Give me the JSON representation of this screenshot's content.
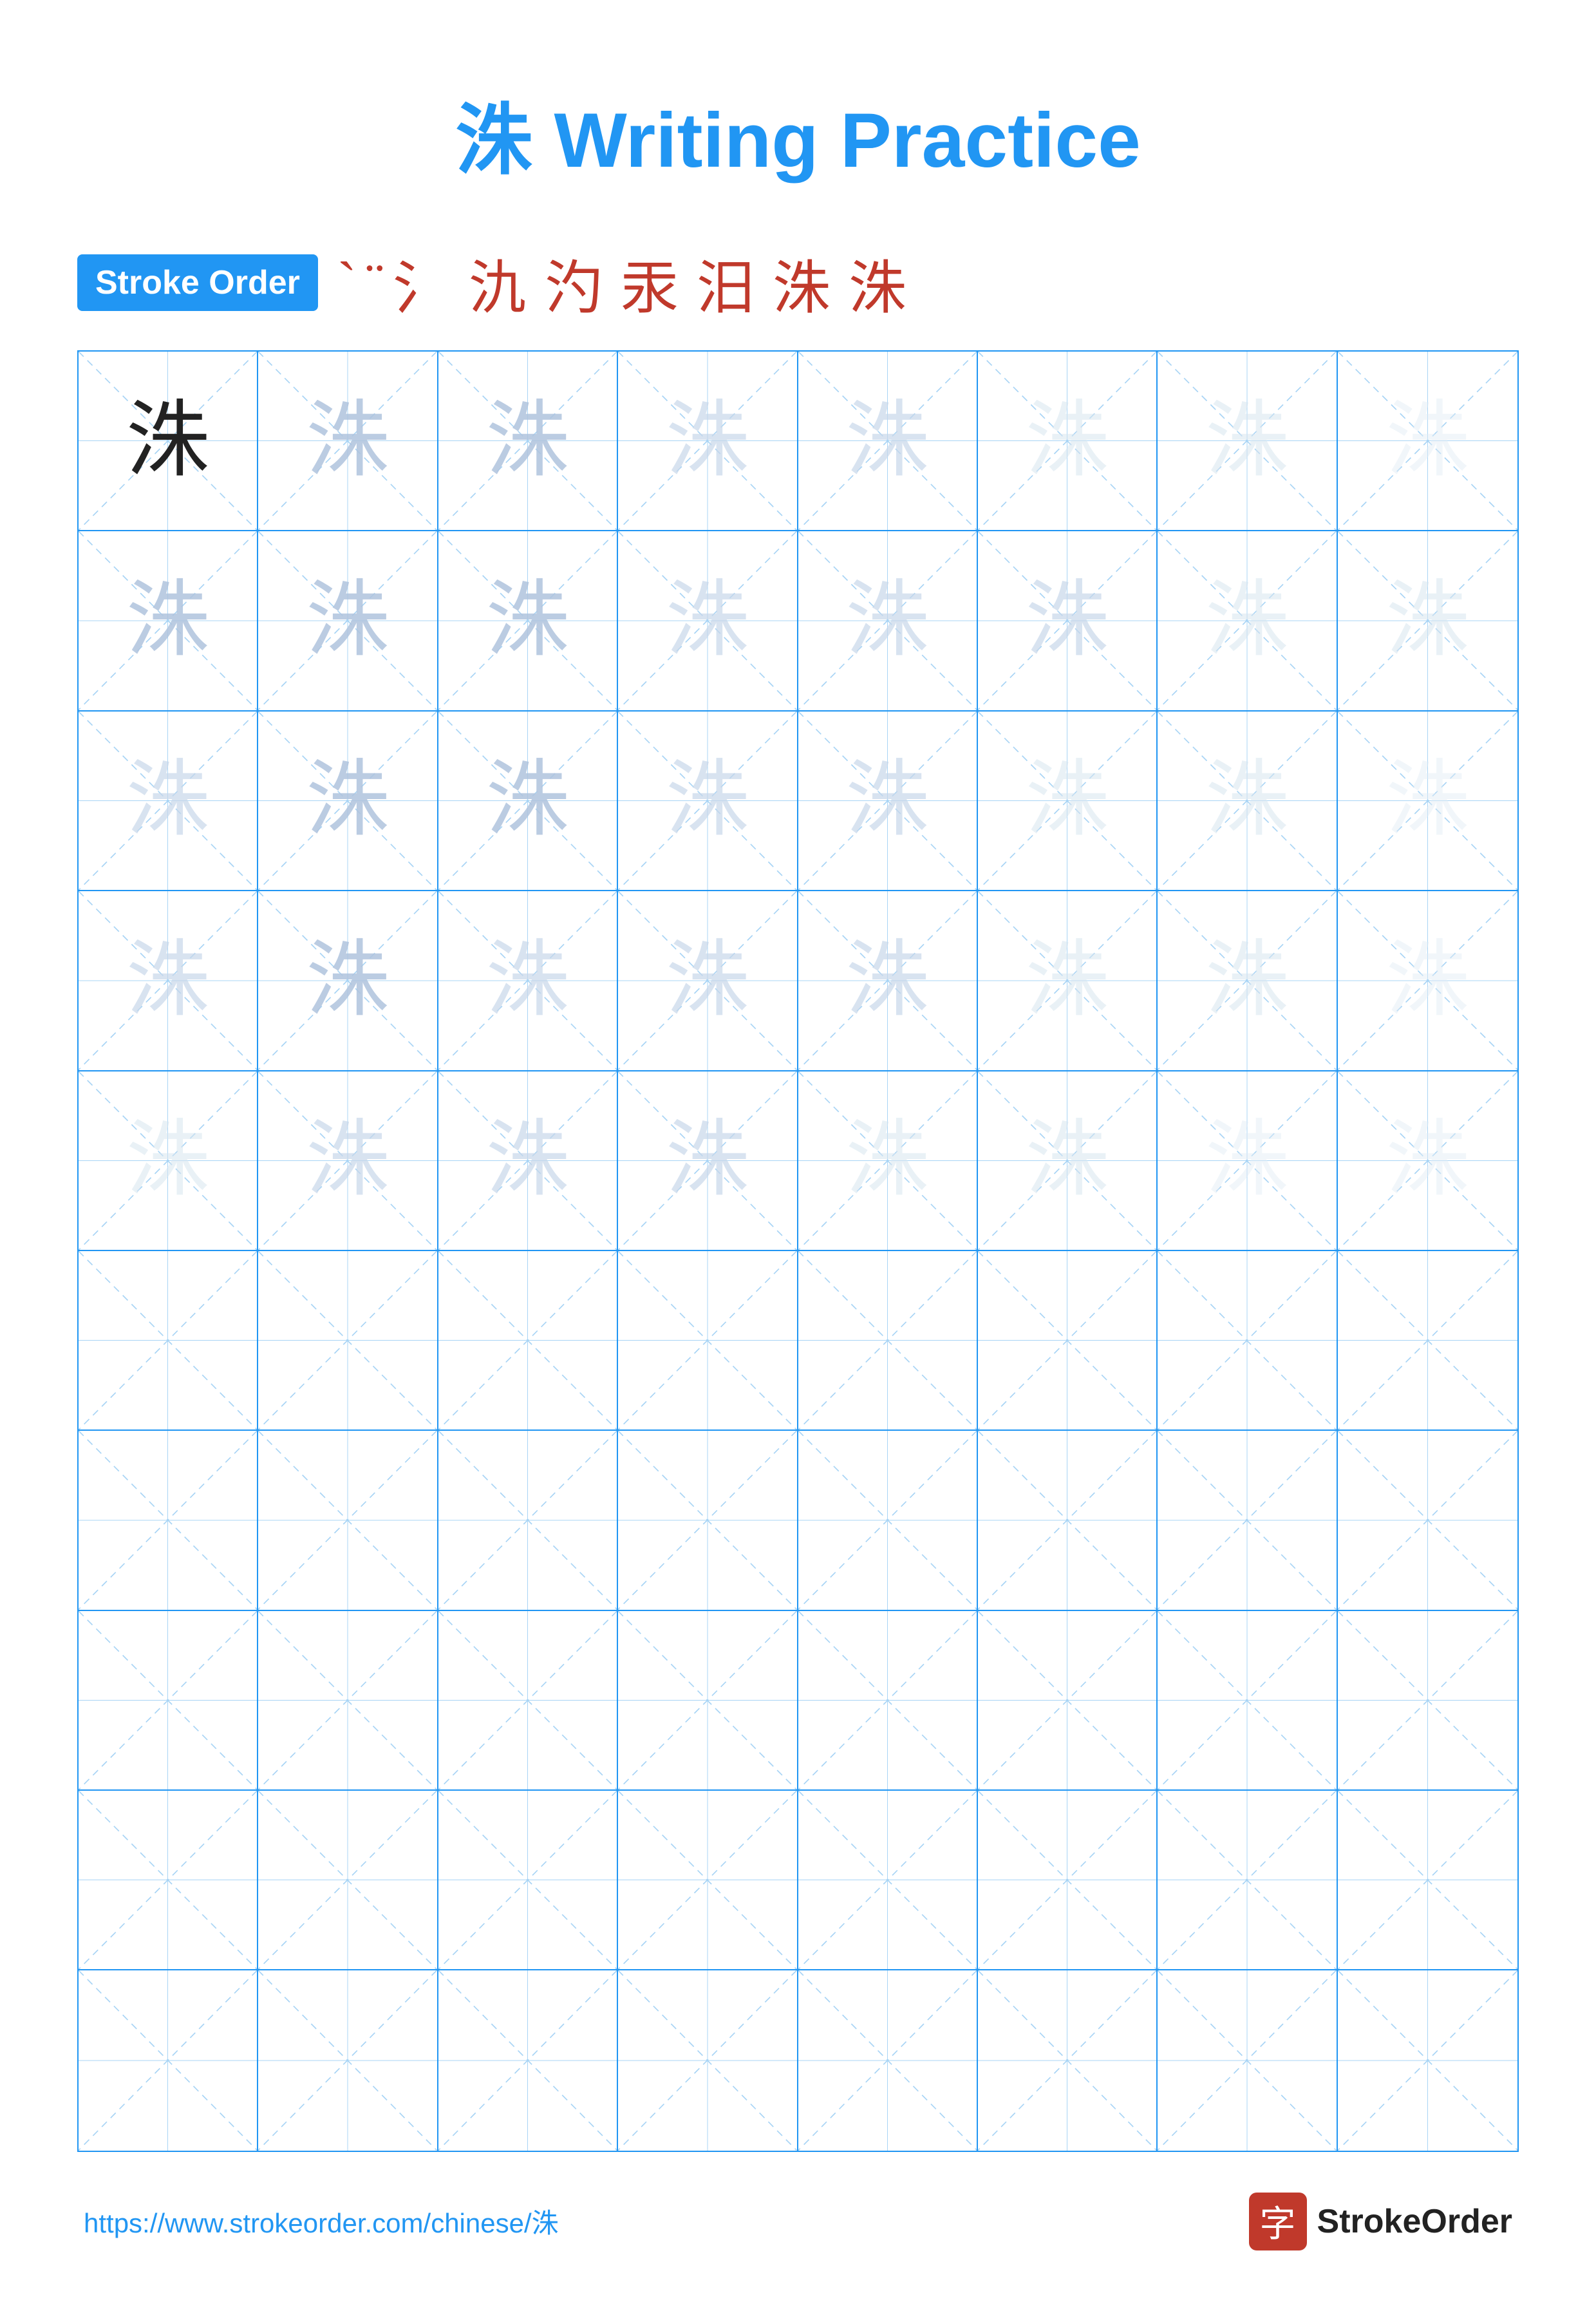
{
  "title": {
    "char": "洙",
    "label": "Writing Practice",
    "full": "洙 Writing Practice"
  },
  "stroke_order": {
    "badge_label": "Stroke Order",
    "strokes": [
      "`",
      "·",
      "⺡",
      "氵",
      "汋",
      "汙",
      "泜",
      "洙"
    ]
  },
  "grid": {
    "rows": 10,
    "cols": 8,
    "practice_char": "洙",
    "filled_rows": 5,
    "empty_rows": 5
  },
  "footer": {
    "url": "https://www.strokeorder.com/chinese/洙",
    "logo_char": "字",
    "logo_text": "StrokeOrder"
  }
}
